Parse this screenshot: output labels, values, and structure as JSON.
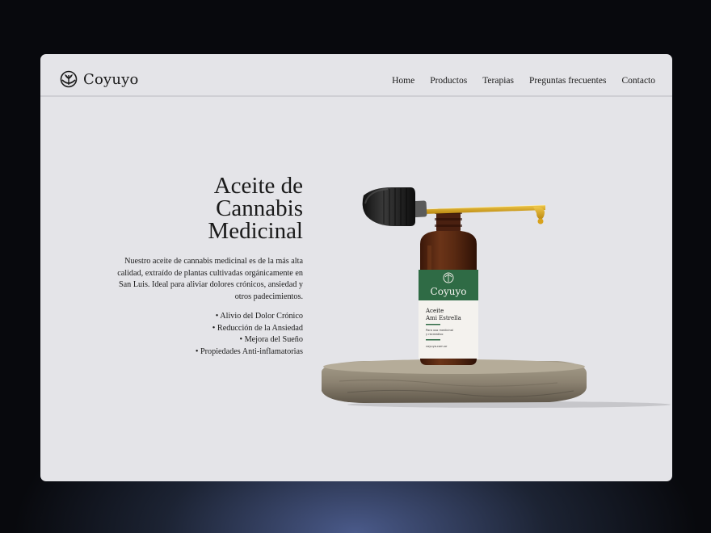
{
  "brand": {
    "name": "Coyuyo",
    "logo_icon": "sunrise-leaf-icon"
  },
  "nav": {
    "items": [
      {
        "label": "Home"
      },
      {
        "label": "Productos"
      },
      {
        "label": "Terapias"
      },
      {
        "label": "Preguntas frecuentes"
      },
      {
        "label": "Contacto"
      }
    ]
  },
  "hero": {
    "title_lines": [
      "Aceite de",
      "Cannabis",
      "Medicinal"
    ],
    "description": "Nuestro aceite de cannabis medicinal es de la más alta calidad, extraído de plantas cultivadas orgánicamente en San Luis. Ideal para aliviar dolores crónicos, ansiedad y otros padecimientos.",
    "benefits": [
      "• Alivio del Dolor Crónico",
      "• Reducción de la Ansiedad",
      "• Mejora del Sueño",
      "• Propiedades Anti-inflamatorias"
    ]
  },
  "product": {
    "label_brand": "Coyuyo",
    "label_name_line1": "Aceite",
    "label_name_line2": "Ami Estrella",
    "label_use_line1": "Para uso medicinal",
    "label_use_line2": "y recreativo",
    "label_url": "coyuyo.com.ar"
  },
  "colors": {
    "page_bg": "#e4e4e8",
    "label_green": "#2f6b45",
    "bottle_amber": "#5a2a14",
    "oil_gold": "#d8a21c"
  }
}
